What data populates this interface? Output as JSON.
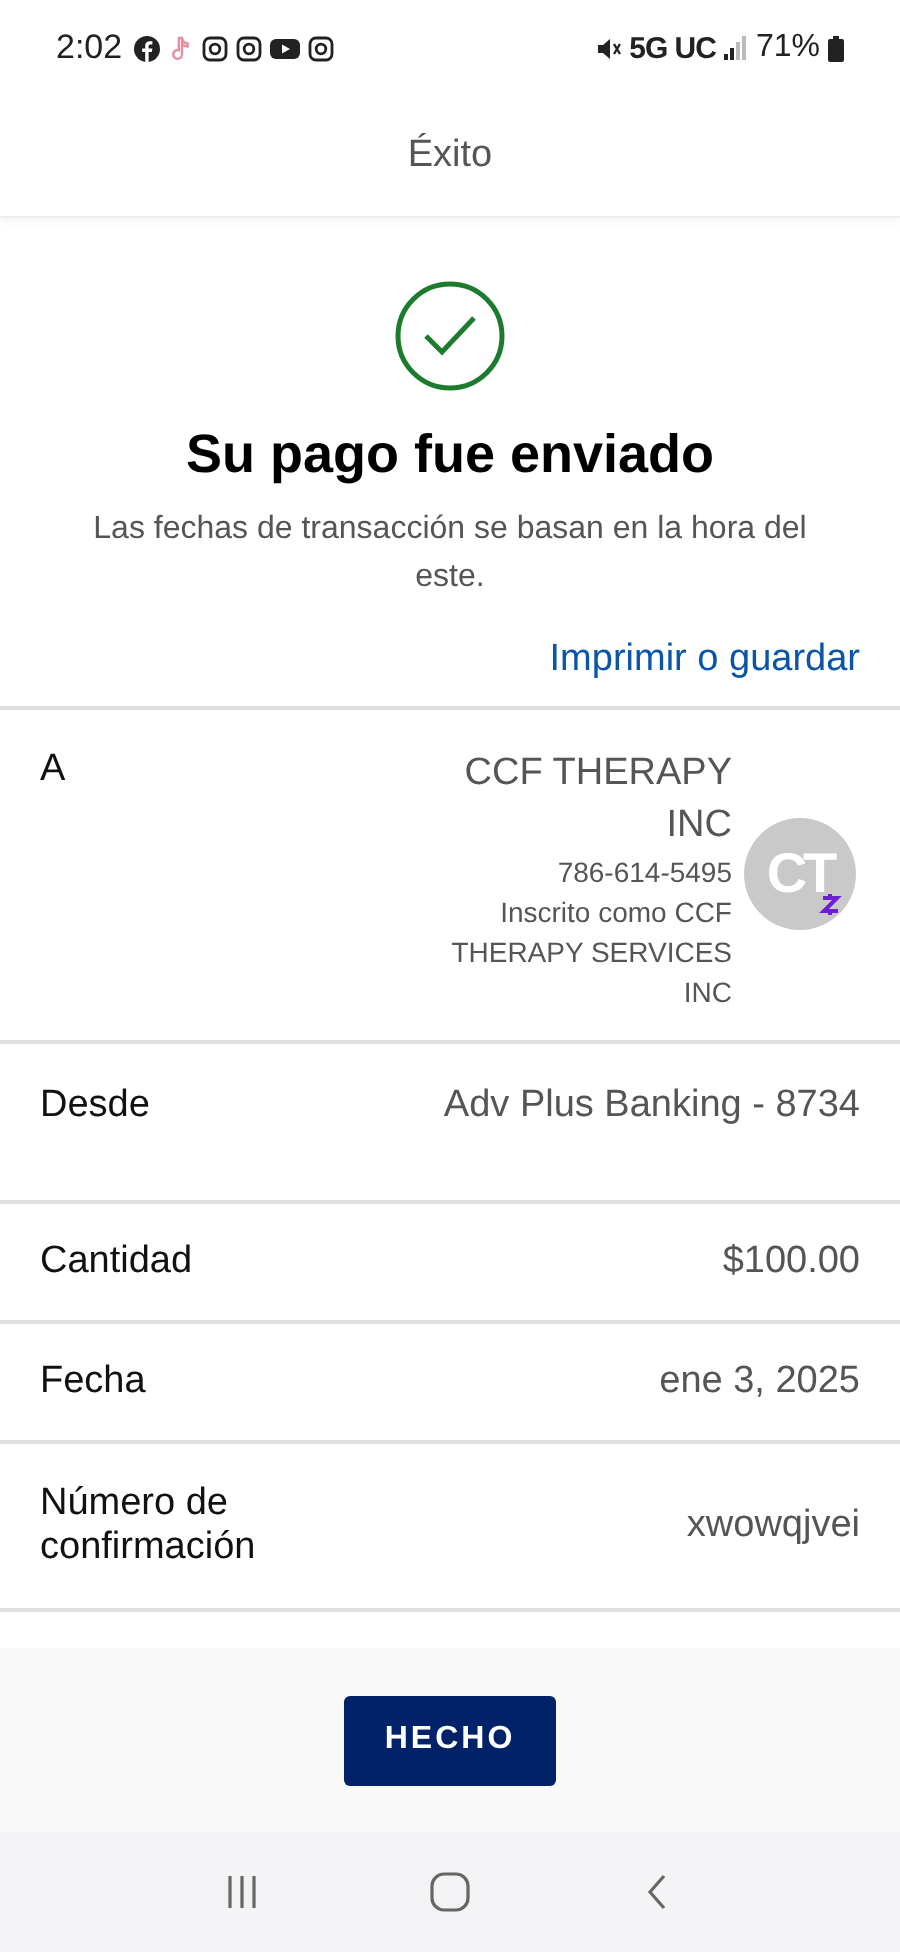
{
  "status_bar": {
    "time": "2:02",
    "network": "5G UC",
    "battery": "71%"
  },
  "header": {
    "title": "Éxito"
  },
  "message": {
    "title": "Su pago fue enviado",
    "subtitle": "Las fechas de transacción se basan en la hora del este."
  },
  "print_link": "Imprimir o guardar",
  "rows": [
    {
      "kind": "recipient",
      "label": "A",
      "name": "CCF THERAPY INC",
      "phone": "786-614-5495",
      "enrolled": "Inscrito como CCF THERAPY SERVICES INC",
      "avatar": "CT"
    },
    {
      "kind": "plain",
      "label": "Desde",
      "value": "Adv Plus Banking - 8734"
    },
    {
      "kind": "plain",
      "label": "Cantidad",
      "value": "$100.00"
    },
    {
      "kind": "plain",
      "label": "Fecha",
      "value": "ene 3, 2025"
    },
    {
      "kind": "plain",
      "label": "Número de confirmación",
      "value": "xwowqjvei"
    }
  ],
  "done_button": "HECHO"
}
